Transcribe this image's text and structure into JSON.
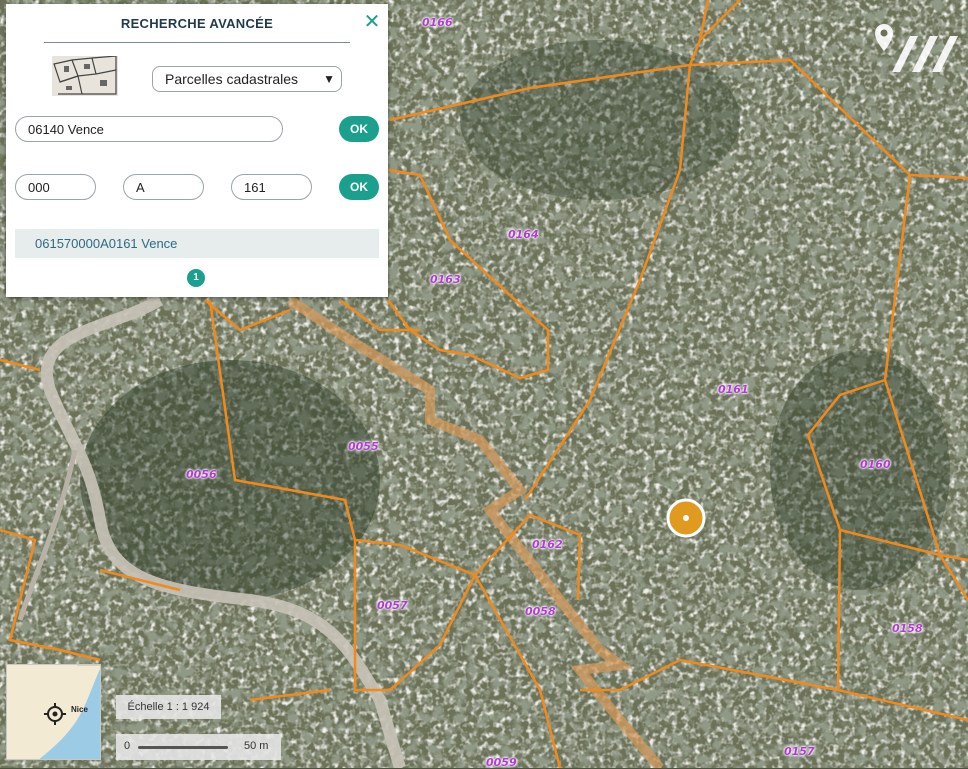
{
  "panel": {
    "title": "RECHERCHE AVANCÉE",
    "close_icon": "close-icon",
    "search_type": "Parcelles cadastrales",
    "commune_value": "06140 Vence",
    "ok_label": "OK",
    "prefix_value": "000",
    "section_value": "A",
    "number_value": "161",
    "result": "061570000A0161 Vence",
    "page": "1"
  },
  "map": {
    "labels": [
      "0166",
      "0164",
      "0163",
      "0161",
      "0160",
      "0055",
      "0056",
      "0162",
      "0057",
      "0058",
      "0158",
      "0059",
      "0157"
    ],
    "parcel_color": "#f08a1c",
    "label_color": "#b23bd6"
  },
  "minimap": {
    "city": "Nice"
  },
  "scale": {
    "ratio": "Échelle 1 : 1 924",
    "zero": "0",
    "distance": "50 m"
  }
}
